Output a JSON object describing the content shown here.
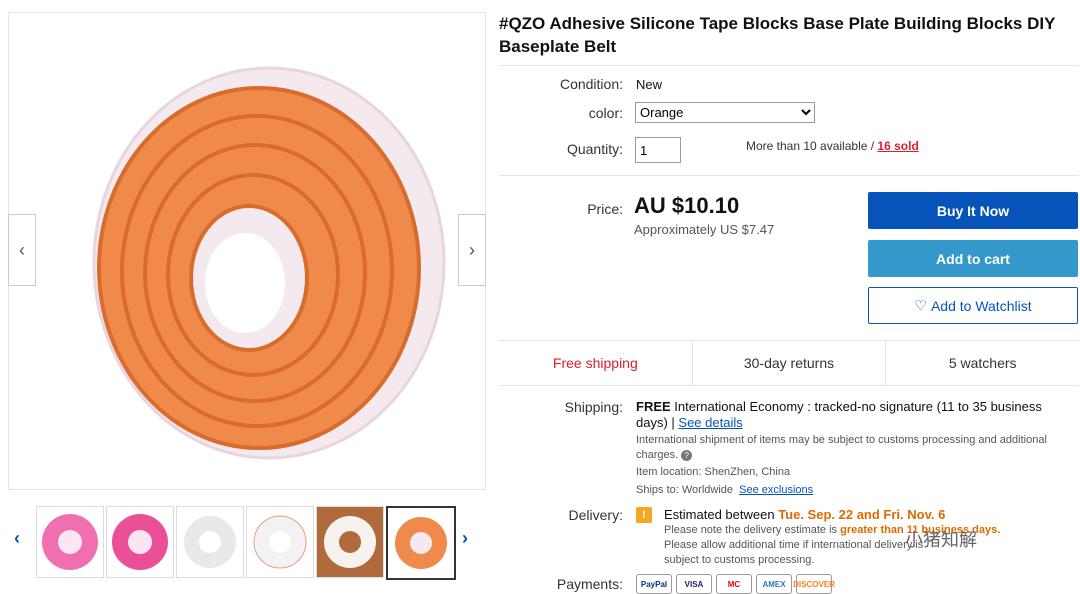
{
  "listing": {
    "title": "#QZO Adhesive Silicone Tape Blocks Base Plate Building Blocks DIY Baseplate Belt",
    "condition_label": "Condition:",
    "condition_value": "New",
    "color_label": "color:",
    "color_value": "Orange",
    "quantity_label": "Quantity:",
    "quantity_value": "1",
    "availability_text": "More than 10 available / ",
    "sold_link": "16 sold"
  },
  "price": {
    "label": "Price:",
    "value": "AU $10.10",
    "approx": "Approximately US $7.47"
  },
  "actions": {
    "buy_now": "Buy It Now",
    "add_to_cart": "Add to cart",
    "watchlist": "Add to Watchlist"
  },
  "highlights": {
    "shipping": "Free shipping",
    "returns": "30-day returns",
    "watchers": "5 watchers"
  },
  "shipping": {
    "label": "Shipping:",
    "free": "FREE",
    "method": "International Economy : tracked-no signature (11 to 35 business days) |",
    "details_link": "See details",
    "customs_note": "International shipment of items may be subject to customs processing and additional charges.",
    "location_label": "Item location:",
    "location_value": "ShenZhen, China",
    "ships_to_label": "Ships to:",
    "ships_to_value": "Worldwide",
    "exclusions_link": "See exclusions"
  },
  "delivery": {
    "label": "Delivery:",
    "estimated_prefix": "Estimated between ",
    "dates": "Tue. Sep. 22 and Fri. Nov. 6",
    "note_prefix": "Please note the delivery estimate is ",
    "note_emphasis": "greater than 11 business days.",
    "note2": "Please allow additional time if international delivery is subject to customs processing."
  },
  "payments": {
    "label": "Payments:",
    "cards": [
      "PayPal",
      "VISA",
      "MC",
      "AMEX",
      "DISCOVER"
    ]
  },
  "watermark": "小猪知解",
  "colors": {
    "primary_blue": "#0654ba",
    "cart_blue": "#3498ca",
    "alert_red": "#dd1e31",
    "product_orange": "#f08a4b"
  }
}
